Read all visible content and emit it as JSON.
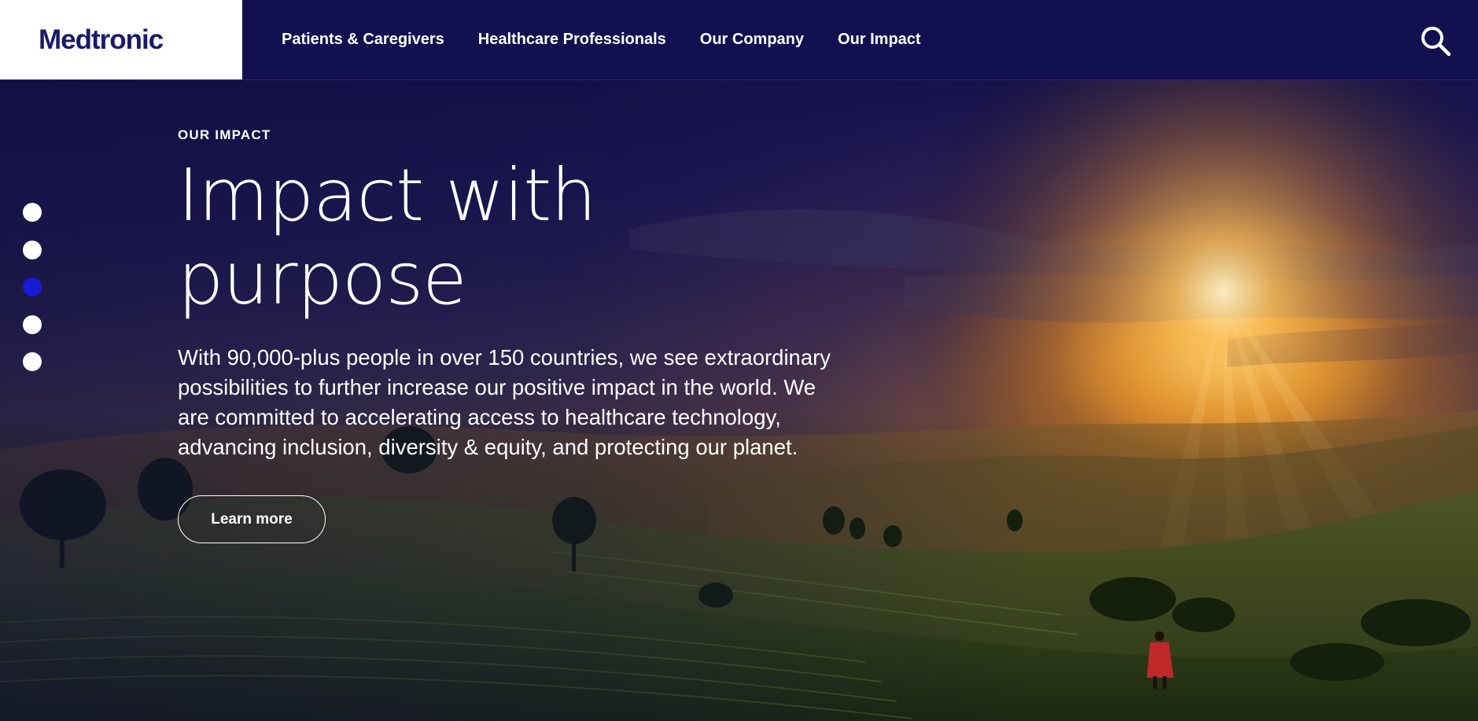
{
  "brand": {
    "logo_text": "Medtronic"
  },
  "nav": {
    "items": [
      {
        "label": "Patients & Caregivers"
      },
      {
        "label": "Healthcare Professionals"
      },
      {
        "label": "Our Company"
      },
      {
        "label": "Our Impact"
      }
    ],
    "search_icon": "search-icon"
  },
  "hero": {
    "eyebrow": "OUR IMPACT",
    "headline_line1": "Impact with",
    "headline_line2": "purpose",
    "body": "With 90,000-plus people in over 150 countries, we see extraordinary possibilities to further increase our positive impact in the world. We are committed to accelerating access to healthcare technology, advancing inclusion, diversity & equity, and protecting our planet.",
    "cta_label": "Learn more"
  },
  "carousel": {
    "slide_count": 5,
    "active_index": 2
  },
  "colors": {
    "header_bg": "#131050",
    "logo_text": "#1b1a68",
    "active_dot": "#1b1bd6",
    "inactive_dot": "#ffffff"
  }
}
